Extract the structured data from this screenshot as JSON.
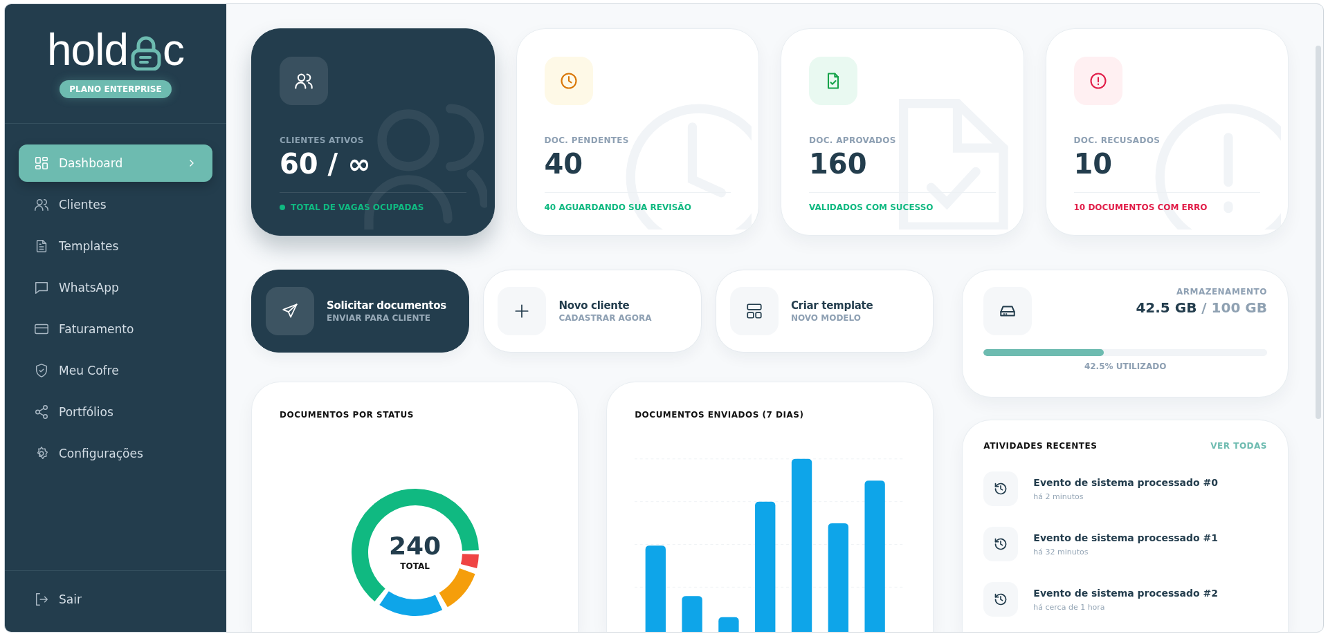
{
  "sidebar": {
    "logo": {
      "before": "hold",
      "after": "c"
    },
    "plan_badge": "PLANO ENTERPRISE",
    "items": [
      {
        "label": "Dashboard",
        "selected": true
      },
      {
        "label": "Clientes",
        "selected": false
      },
      {
        "label": "Templates",
        "selected": false
      },
      {
        "label": "WhatsApp",
        "selected": false
      },
      {
        "label": "Faturamento",
        "selected": false
      },
      {
        "label": "Meu Cofre",
        "selected": false
      },
      {
        "label": "Portfólios",
        "selected": false
      },
      {
        "label": "Configurações",
        "selected": false
      }
    ],
    "logout": "Sair"
  },
  "stats": [
    {
      "kind": "clients",
      "label": "CLIENTES ATIVOS",
      "value": "60 / ∞",
      "footer": "TOTAL DE VAGAS OCUPADAS"
    },
    {
      "kind": "pending",
      "label": "DOC. PENDENTES",
      "value": "40",
      "footer": "40 AGUARDANDO SUA REVISÃO"
    },
    {
      "kind": "approved",
      "label": "DOC. APROVADOS",
      "value": "160",
      "footer": "VALIDADOS COM SUCESSO"
    },
    {
      "kind": "refused",
      "label": "DOC. RECUSADOS",
      "value": "10",
      "footer": "10 DOCUMENTOS COM ERRO"
    }
  ],
  "actions": [
    {
      "kind": "primary",
      "title": "Solicitar documentos",
      "subtitle": "ENVIAR PARA CLIENTE"
    },
    {
      "kind": "plain",
      "title": "Novo cliente",
      "subtitle": "CADASTRAR AGORA"
    },
    {
      "kind": "plain",
      "title": "Criar template",
      "subtitle": "NOVO MODELO"
    }
  ],
  "storage": {
    "label": "ARMAZENAMENTO",
    "used": "42.5 GB",
    "total": "/ 100 GB",
    "level": 0.425,
    "caption": "42.5% UTILIZADO"
  },
  "status_chart": {
    "title": "DOCUMENTOS POR STATUS",
    "total": "240",
    "total_label": "TOTAL"
  },
  "sent_chart": {
    "title": "DOCUMENTOS ENVIADOS (7 DIAS)"
  },
  "activities": {
    "title": "ATIVIDADES RECENTES",
    "link": "VER TODAS",
    "items": [
      {
        "title": "Evento de sistema processado #0",
        "time": "há 2 minutos"
      },
      {
        "title": "Evento de sistema processado #1",
        "time": "há 32 minutos"
      },
      {
        "title": "Evento de sistema processado #2",
        "time": "há cerca de 1 hora"
      }
    ]
  }
}
